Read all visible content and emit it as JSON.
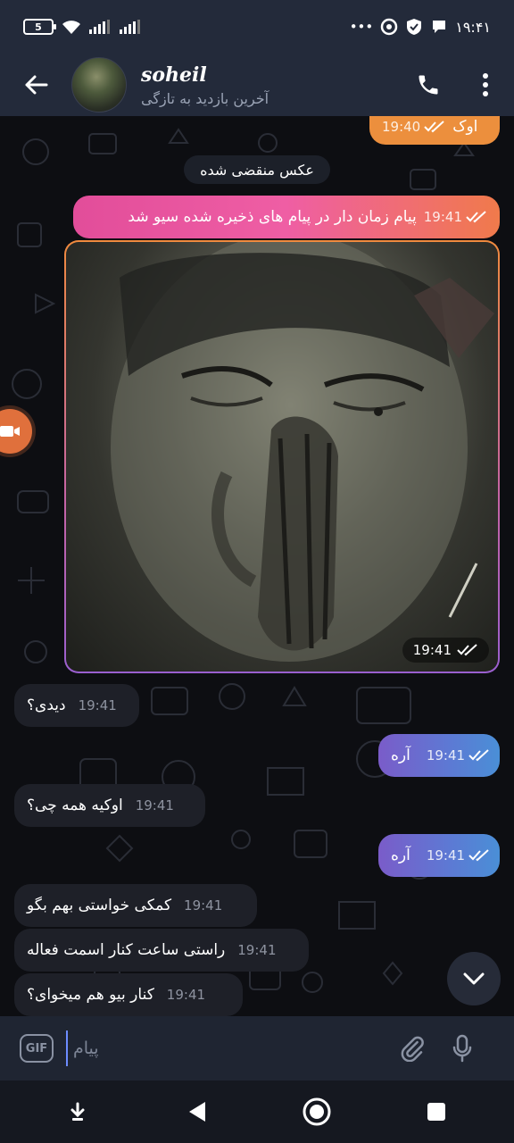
{
  "status_bar": {
    "battery": "5",
    "time": "۱۹:۴۱"
  },
  "header": {
    "contact_name": "soheil",
    "last_seen": "آخرین بازدید به تازگی"
  },
  "messages": {
    "ok": {
      "text": "اوک",
      "time": "19:40"
    },
    "service": "عکس منقضی شده",
    "saved_notice": {
      "text": "پیام زمان دار در پیام های ذخیره شده سیو شد",
      "time": "19:41"
    },
    "photo_time": "19:41",
    "didi": {
      "text": "دیدی؟",
      "time": "19:41"
    },
    "are_1": {
      "text": "آره",
      "time": "19:41"
    },
    "okie": {
      "text": "اوکیه همه چی؟",
      "time": "19:41"
    },
    "are_2": {
      "text": "آره",
      "time": "19:41"
    },
    "help": {
      "text": "کمکی خواستی بهم بگو",
      "time": "19:41"
    },
    "clock": {
      "text": "راستی ساعت کنار اسمت فعاله",
      "time": "19:41"
    },
    "bio": {
      "text": "کنار بیو هم میخوای؟",
      "time": "19:41"
    }
  },
  "composer": {
    "gif_label": "GIF",
    "placeholder": "پیام"
  },
  "colors": {
    "header_bg": "#232a3a",
    "outgoing_orange": "#ec8f3d",
    "outgoing_pink": "#e24d9a",
    "outgoing_blue": "#5c7ad4",
    "incoming_bg": "#1e2028"
  }
}
